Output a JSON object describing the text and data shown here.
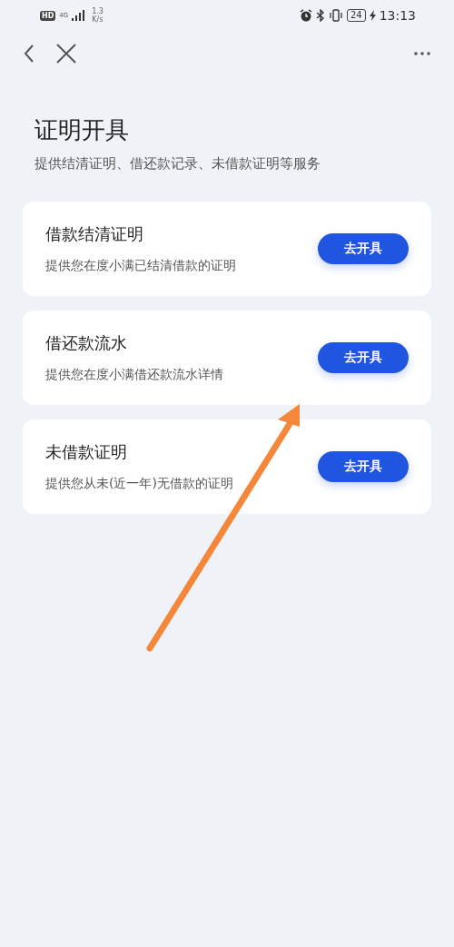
{
  "status_bar": {
    "hd": "HD",
    "network": "4G",
    "speed_value": "1.3",
    "speed_unit": "K/s",
    "battery": "24",
    "time": "13:13"
  },
  "page": {
    "title": "证明开具",
    "subtitle": "提供结清证明、借还款记录、未借款证明等服务"
  },
  "cards": [
    {
      "title": "借款结清证明",
      "description": "提供您在度小满已结清借款的证明",
      "button": "去开具"
    },
    {
      "title": "借还款流水",
      "description": "提供您在度小满借还款流水详情",
      "button": "去开具"
    },
    {
      "title": "未借款证明",
      "description": "提供您从未(近一年)无借款的证明",
      "button": "去开具"
    }
  ]
}
